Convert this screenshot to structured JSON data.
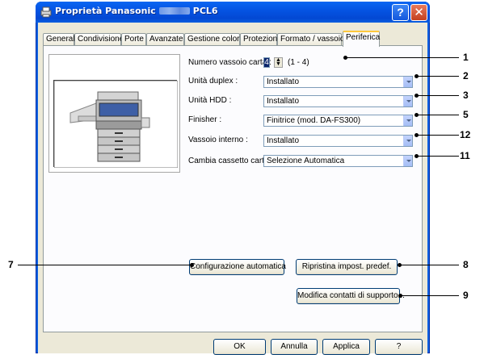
{
  "window": {
    "title_prefix": "Proprietà Panasonic",
    "title_suffix": "PCL6",
    "help_glyph": "?",
    "close_glyph": "✕"
  },
  "tabs": [
    {
      "label": "Generale"
    },
    {
      "label": "Condivisione"
    },
    {
      "label": "Porte"
    },
    {
      "label": "Avanzate"
    },
    {
      "label": "Gestione colori"
    },
    {
      "label": "Protezione"
    },
    {
      "label": "Formato / vassoio"
    },
    {
      "label": "Periferica",
      "active": true
    }
  ],
  "settings": {
    "tray_count": {
      "label": "Numero vassoio carta :",
      "value": "4",
      "range": "(1 - 4)"
    },
    "duplex": {
      "label": "Unità duplex :",
      "value": "Installato"
    },
    "hdd": {
      "label": "Unità HDD :",
      "value": "Installato"
    },
    "finisher": {
      "label": "Finisher :",
      "value": "Finitrice (mod. DA-FS300)"
    },
    "inner_tray": {
      "label": "Vassoio interno :",
      "value": "Installato"
    },
    "cassette_change": {
      "label": "Cambia cassetto carta :",
      "value": "Selezione Automatica"
    }
  },
  "buttons": {
    "auto_config": "Configurazione automatica",
    "restore_defaults": "Ripristina impost. predef.",
    "edit_support": "Modifica contatti di supporto...",
    "ok": "OK",
    "cancel": "Annulla",
    "apply": "Applica",
    "help": "?"
  },
  "callouts": {
    "tray_count": "1",
    "duplex": "2",
    "hdd": "3",
    "finisher": "5",
    "inner_tray": "12",
    "cassette_change": "11",
    "auto_config": "7",
    "restore_defaults": "8",
    "edit_support": "9"
  },
  "colors": {
    "titlebar": "#0554e3",
    "dialog_bg": "#ece9d8",
    "active_tab_highlight": "#ffc83c"
  }
}
